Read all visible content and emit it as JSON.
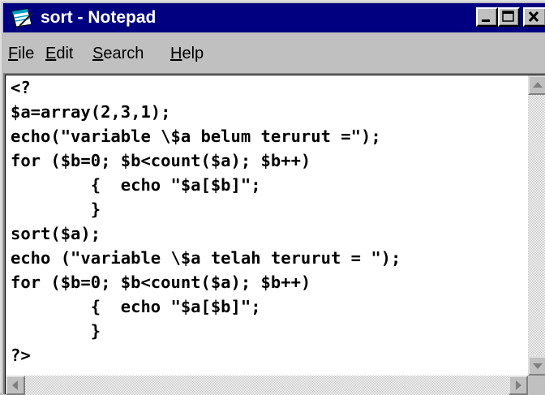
{
  "window": {
    "title": "sort - Notepad",
    "icon": "notepad-icon",
    "colors": {
      "titlebar": "#000080",
      "face": "#c0c0c0",
      "editor_bg": "#ffffff"
    }
  },
  "title_buttons": [
    {
      "name": "minimize-button",
      "icon": "minimize-icon"
    },
    {
      "name": "maximize-button",
      "icon": "maximize-icon"
    },
    {
      "name": "close-button",
      "icon": "close-icon"
    }
  ],
  "menu": {
    "items": [
      {
        "accel": "F",
        "rest": "ile"
      },
      {
        "accel": "E",
        "rest": "dit"
      },
      {
        "accel": "S",
        "rest": "earch"
      },
      {
        "accel": "H",
        "rest": "elp"
      }
    ]
  },
  "editor": {
    "lines": [
      "<?",
      "$a=array(2,3,1);",
      "echo(\"variable \\$a belum terurut =\");",
      "for ($b=0; $b<count($a); $b++)",
      "        {  echo \"$a[$b]\";",
      "        }",
      "sort($a);",
      "echo (\"variable \\$a telah terurut = \");",
      "for ($b=0; $b<count($a); $b++)",
      "        {  echo \"$a[$b]\";",
      "        }",
      "?>"
    ]
  },
  "scrollbars": {
    "vertical": {
      "up": "scroll-up-arrow-icon",
      "down": "scroll-down-arrow-icon"
    },
    "horizontal": {
      "left": "scroll-left-arrow-icon",
      "right": "scroll-right-arrow-icon"
    }
  }
}
